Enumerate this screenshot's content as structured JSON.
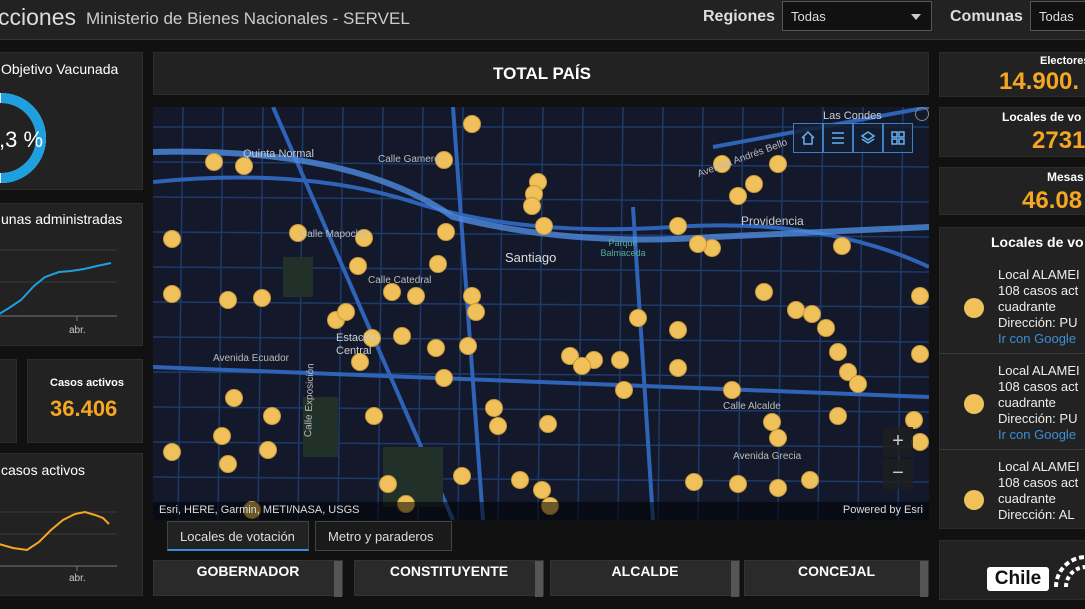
{
  "header": {
    "title": "cciones",
    "subtitle": "Ministerio de Bienes Nacionales - SERVEL",
    "regiones_label": "Regiones",
    "regiones_value": "Todas",
    "comunas_label": "Comunas",
    "comunas_value": "Todas"
  },
  "left": {
    "vacunada_title": "Objetivo Vacunada",
    "vacunada_pct": ",3 %",
    "vacunas_title": "unas administradas",
    "vacunas_tick": "abr.",
    "casos_label": "Casos activos",
    "casos_value": "36.406",
    "casos_chart_title": "casos activos",
    "casos_tick": "abr."
  },
  "center": {
    "total_title": "TOTAL PAÍS",
    "map_labels": [
      "Las Condes",
      "Santiago",
      "Providencia",
      "Parque Balmaceda",
      "Quinta Normal",
      "Estación Central",
      "Calle Gamero",
      "Avenida Andrés Bello",
      "Calle Mapocho",
      "Calle Catedral",
      "Avenida Ecuador",
      "Calle Exposición",
      "Avenida Grecia",
      "Calle Alcalde"
    ],
    "attribution": "Esri, HERE, Garmin, METI/NASA, USGS",
    "powered": "Powered by Esri",
    "tabs": [
      "Locales de votación",
      "Metro y paraderos"
    ],
    "buttons": [
      "GOBERNADOR",
      "CONSTITUYENTE",
      "ALCALDE",
      "CONCEJAL"
    ]
  },
  "right": {
    "electores_label": "Electores",
    "electores_value": "14.900.",
    "locales_label": "Locales de vo",
    "locales_value": "2731",
    "mesas_label": "Mesas",
    "mesas_value": "46.08",
    "list_title": "Locales de vo",
    "items": [
      {
        "name": "Local ALAMEI",
        "cases": "108 casos act",
        "sector": "cuadrante",
        "address": "Dirección: PU",
        "link": "Ir con Google"
      },
      {
        "name": "Local ALAMEI",
        "cases": "108 casos act",
        "sector": "cuadrante",
        "address": "Dirección: PU",
        "link": "Ir con Google"
      },
      {
        "name": "Local ALAMEI",
        "cases": "108 casos act",
        "sector": "cuadrante",
        "address": "Dirección: AL",
        "link": ""
      }
    ],
    "logo_text": "Chile"
  },
  "colors": {
    "accent": "#f5a623",
    "ring": "#1ea0e0",
    "line": "#1ea0e0",
    "map_bg": "#13192a",
    "marker": "#f0c15a",
    "link": "#3b8fd9"
  }
}
